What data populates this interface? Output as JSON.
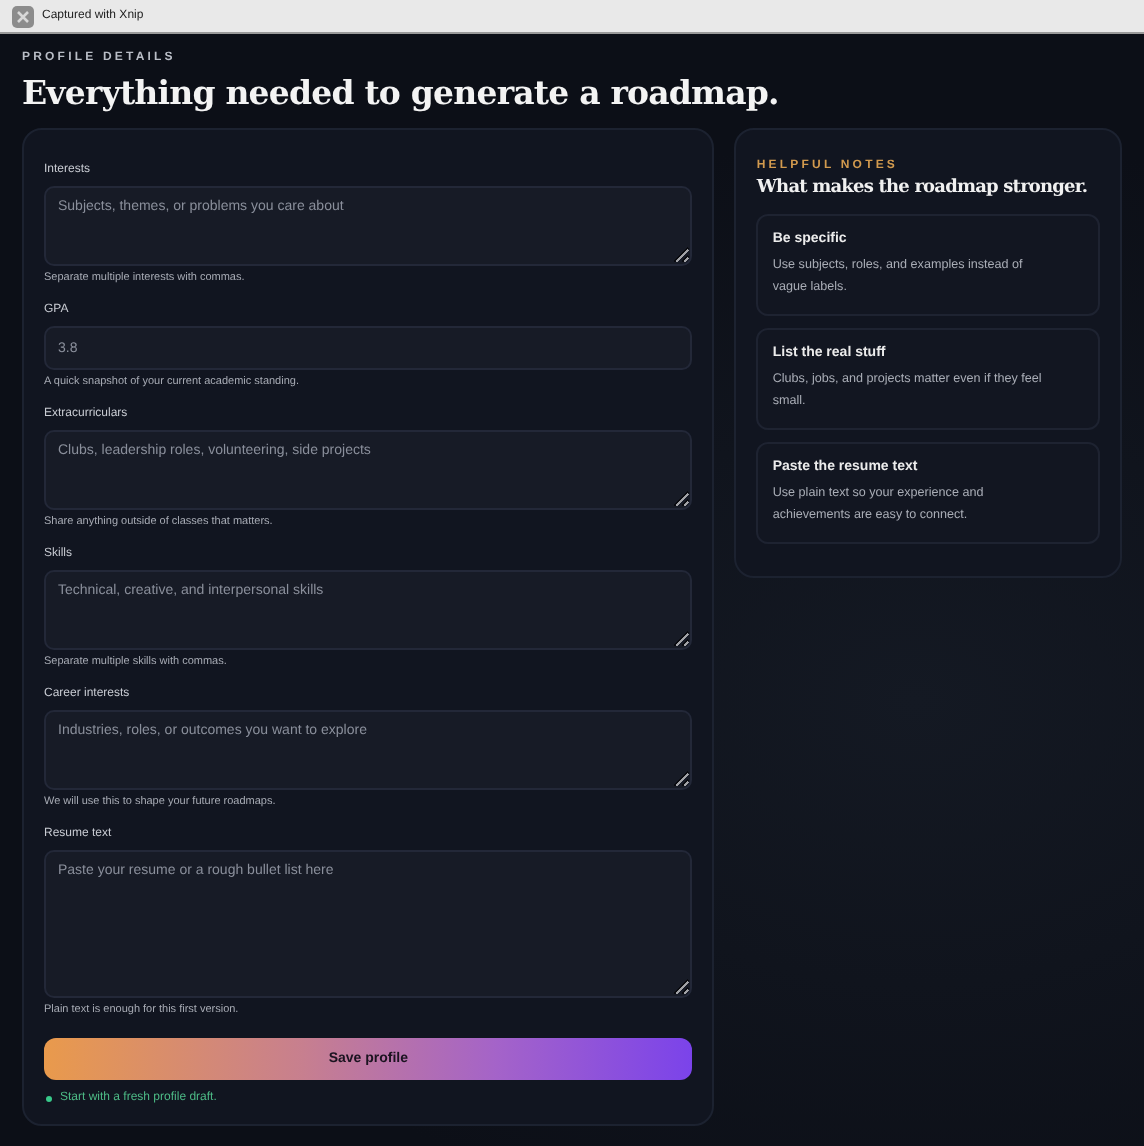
{
  "capture_bar": {
    "title": "Captured with Xnip"
  },
  "header": {
    "eyebrow": "PROFILE DETAILS",
    "title": "Everything needed to generate a roadmap."
  },
  "form": {
    "fields": [
      {
        "kind": "textarea",
        "label": "Interests",
        "placeholder": "Subjects, themes, or problems you care about",
        "hint": "Separate multiple interests with commas."
      },
      {
        "kind": "input",
        "label": "GPA",
        "placeholder": "3.8",
        "hint": "A quick snapshot of your current academic standing."
      },
      {
        "kind": "textarea",
        "label": "Extracurriculars",
        "placeholder": "Clubs, leadership roles, volunteering, side projects",
        "hint": "Share anything outside of classes that matters."
      },
      {
        "kind": "textarea",
        "label": "Skills",
        "placeholder": "Technical, creative, and interpersonal skills",
        "hint": "Separate multiple skills with commas."
      },
      {
        "kind": "textarea",
        "label": "Career interests",
        "placeholder": "Industries, roles, or outcomes you want to explore",
        "hint": "We will use this to shape your future roadmaps."
      },
      {
        "kind": "large-textarea",
        "label": "Resume text",
        "placeholder": "Paste your resume or a rough bullet list here",
        "hint": "Plain text is enough for this first version."
      }
    ],
    "submit": "Save profile",
    "status": "Start with a fresh profile draft."
  },
  "notes": {
    "eyebrow": "HELPFUL NOTES",
    "title": "What makes the roadmap stronger.",
    "cards": [
      {
        "title": "Be specific",
        "body": "Use subjects, roles, and examples instead of vague labels."
      },
      {
        "title": "List the real stuff",
        "body": "Clubs, jobs, and projects matter even if they feel small."
      },
      {
        "title": "Paste the resume text",
        "body": "Use plain text so your experience and achievements are easy to connect."
      }
    ]
  }
}
